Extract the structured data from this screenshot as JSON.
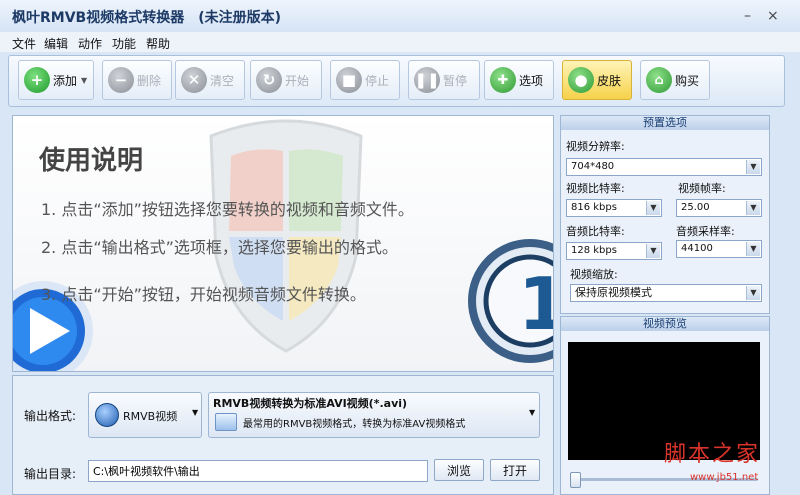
{
  "window": {
    "title": "枫叶RMVB视频格式转换器　(未注册版本)",
    "minimize_glyph": "–",
    "close_glyph": "×"
  },
  "menu": [
    "文件",
    "编辑",
    "动作",
    "功能",
    "帮助"
  ],
  "toolbar": {
    "add": "添加",
    "delete": "删除",
    "clear": "清空",
    "start": "开始",
    "stop": "停止",
    "pause": "暂停",
    "options": "选项",
    "skin": "皮肤",
    "buy": "购买"
  },
  "instructions": {
    "heading": "使用说明",
    "steps": [
      "1. 点击“添加”按钮选择您要转换的视频和音频文件。",
      "2. 点击“输出格式”选项框，选择您要输出的格式。",
      "3. 点击“开始”按钮，开始视频音频文件转换。"
    ],
    "badge_number": "1"
  },
  "presets": {
    "header": "预置选项",
    "video_resolution_label": "视频分辨率:",
    "video_resolution": "704*480",
    "video_bitrate_label": "视频比特率:",
    "video_bitrate": "816 kbps",
    "video_framerate_label": "视频帧率:",
    "video_framerate": "25.00",
    "audio_bitrate_label": "音频比特率:",
    "audio_bitrate": "128 kbps",
    "audio_samplerate_label": "音频采样率:",
    "audio_samplerate": "44100",
    "video_scale_label": "视频缩放:",
    "video_scale": "保持原视频模式"
  },
  "preview": {
    "header": "视频预览"
  },
  "output": {
    "format_label": "输出格式:",
    "format_category": "RMVB视频",
    "format_title": "RMVB视频转换为标准AVI视频(*.avi)",
    "format_desc": "最常用的RMVB视频格式，转换为标准AV视频格式",
    "dir_label": "输出目录:",
    "dir_value": "C:\\枫叶视频软件\\输出",
    "browse": "浏览",
    "open": "打开"
  },
  "watermark": {
    "text": "脚本之家",
    "url": "www.jb51.net"
  },
  "colors": {
    "accent": "#1d3a66",
    "window_bg": "#d9e6f5",
    "add_green": "#2eae3a",
    "options_green": "#3aa93f",
    "skin_bg": "#fbe88a",
    "watermark_red": "#d9342b"
  }
}
